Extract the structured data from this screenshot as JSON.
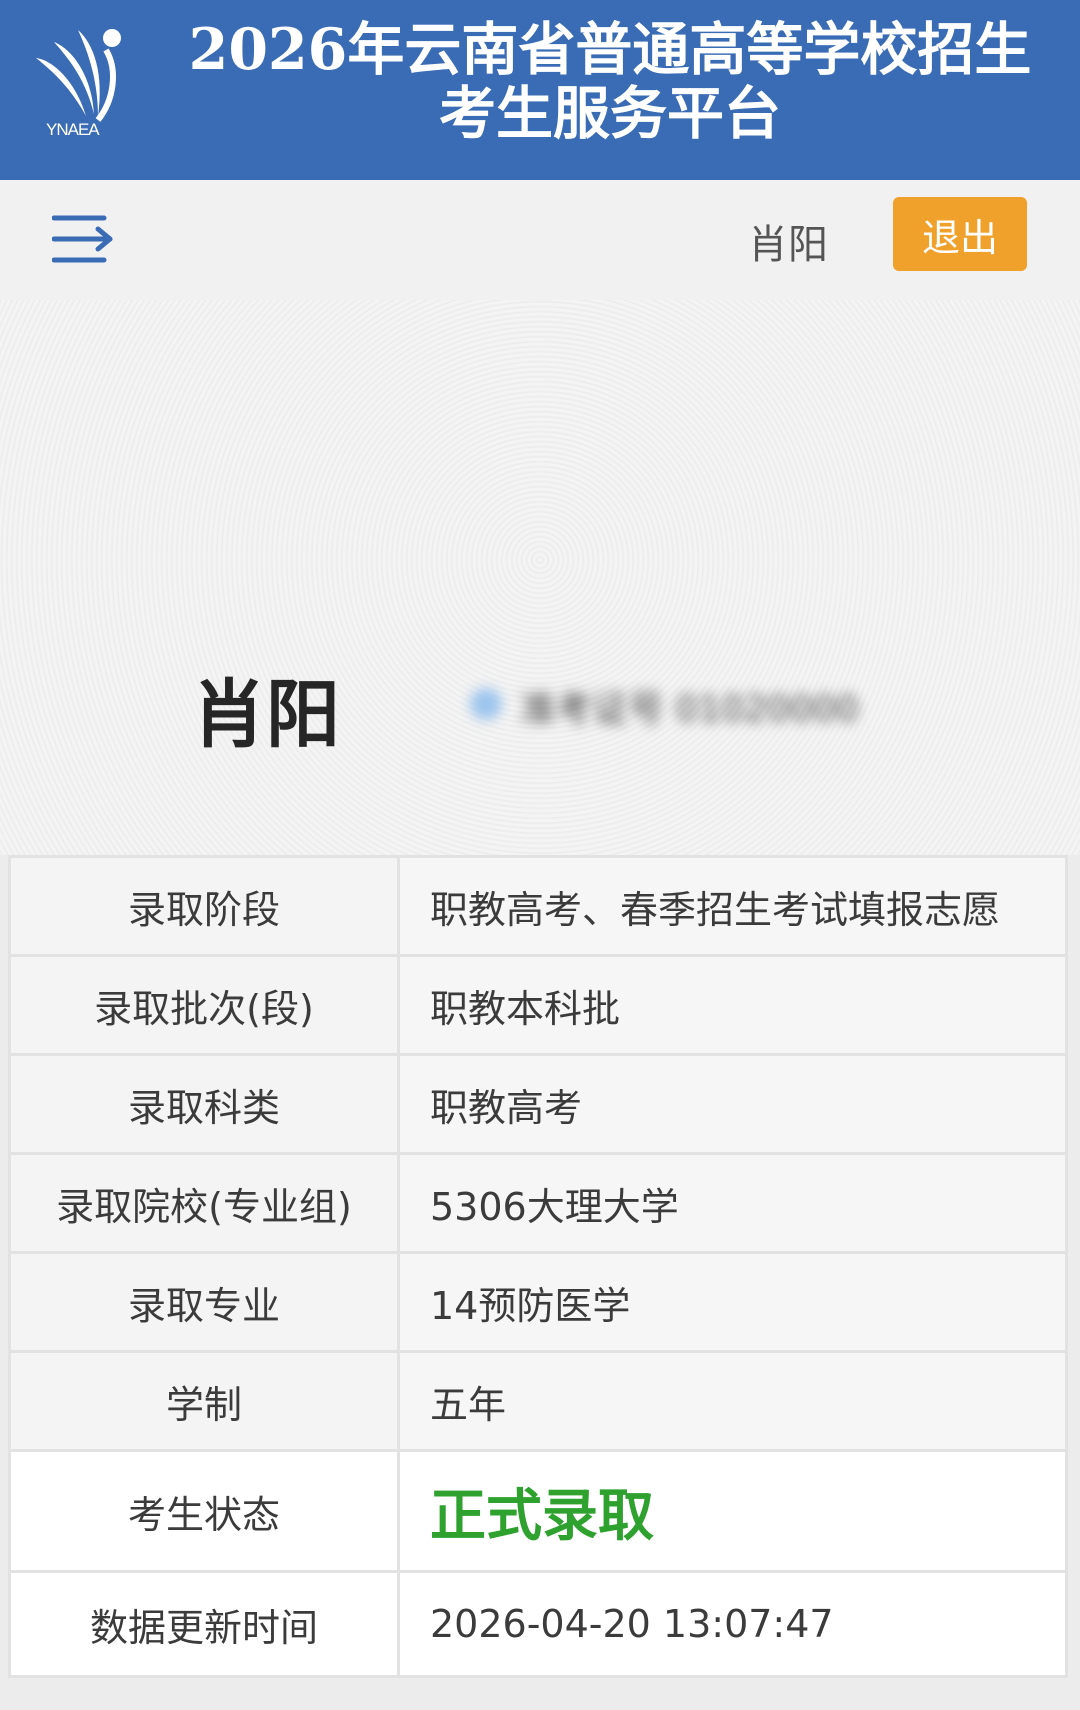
{
  "header": {
    "logo_text": "YNAEA",
    "title": "2026年云南省普通高等学校招生考生服务平台"
  },
  "topbar": {
    "username": "肖阳",
    "logout_label": "退出"
  },
  "profile": {
    "name": "肖阳",
    "blurred_text": "准考证号 01020000"
  },
  "admission": {
    "rows": [
      {
        "label": "录取阶段",
        "value": "职教高考、春季招生考试填报志愿"
      },
      {
        "label": "录取批次(段)",
        "value": "职教本科批"
      },
      {
        "label": "录取科类",
        "value": "职教高考"
      },
      {
        "label": "录取院校(专业组)",
        "value": "5306大理大学"
      },
      {
        "label": "录取专业",
        "value": "14预防医学"
      },
      {
        "label": "学制",
        "value": "五年"
      },
      {
        "label": "考生状态",
        "value": "正式录取"
      },
      {
        "label": "数据更新时间",
        "value": "2026-04-20 13:07:47"
      }
    ]
  },
  "colors": {
    "header_bg": "#3a6cb5",
    "logout_bg": "#f0a12b",
    "status_green": "#2ea12e",
    "menu_icon": "#3a6cb5"
  },
  "icons": {
    "menu": "menu-icon",
    "logo": "ynaea-logo-icon"
  }
}
